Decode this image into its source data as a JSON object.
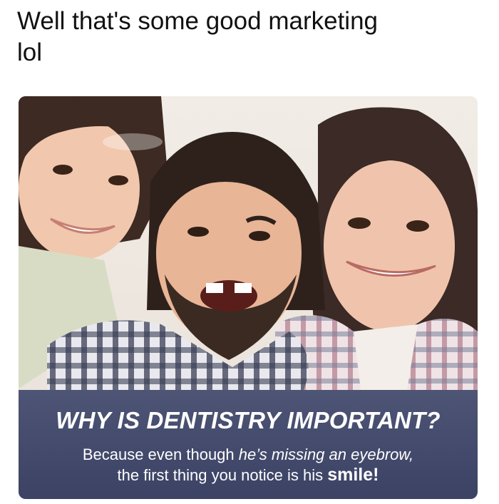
{
  "post": {
    "caption_line1": "Well that's some good marketing",
    "caption_line2": "lol"
  },
  "ad": {
    "headline": "WHY IS DENTISTRY IMPORTANT?",
    "body": {
      "line1_start": "Because even though ",
      "line1_italic": "he’s missing an eyebrow,",
      "line2_start": "the first thing you notice is his ",
      "line2_bold": "smile!"
    }
  },
  "colors": {
    "banner": "#404a6c",
    "banner_text": "#ffffff",
    "background": "#ffffff"
  }
}
